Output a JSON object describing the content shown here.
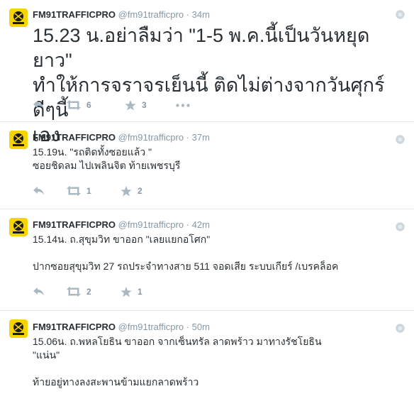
{
  "colors": {
    "avatar_bg": "#f5d400",
    "name": "#292f33",
    "meta": "#8899a6",
    "icon": "#aab8c2"
  },
  "tweets": [
    {
      "fullname": "FM91TRAFFICPRO",
      "username": "@fm91trafficpro",
      "separator": "·",
      "time": "34m",
      "text_lines": [
        "15.23 น.อย่าลืมว่า \"1-5 พ.ค.นี้เป็นวันหยุดยาว\"",
        "ทำให้การจราจรเย็นนี้ ติดไม่ต่างจากวันศุกร์ดีๆนี้",
        "เอง"
      ],
      "retweets": "6",
      "favorites": "3"
    },
    {
      "fullname": "FM91TRAFFICPRO",
      "username": "@fm91trafficpro",
      "separator": "·",
      "time": "37m",
      "text_lines": [
        "15.19น. \"รถติดทั้งซอยแล้ว \"",
        "ซอยชิดลม ไปเพลินจิต ท้ายเพชรบุรี"
      ],
      "retweets": "1",
      "favorites": "2"
    },
    {
      "fullname": "FM91TRAFFICPRO",
      "username": "@fm91trafficpro",
      "separator": "·",
      "time": "42m",
      "text_lines": [
        "15.14น. ถ.สุขุมวิท ขาออก \"เลยแยกอโศก\"",
        "",
        "ปากซอยสุขุมวิท 27 รถประจำทางสาย 511 จอดเสีย ระบบเกียร์ /เบรคล็อค"
      ],
      "retweets": "2",
      "favorites": "1"
    },
    {
      "fullname": "FM91TRAFFICPRO",
      "username": "@fm91trafficpro",
      "separator": "·",
      "time": "50m",
      "text_lines": [
        "15.06น. ถ.พหลโยธิน ขาออก จากเซ็นทรัล ลาดพร้าว มาทางรัชโยธิน",
        "\"แน่น\"",
        "",
        "ท้ายอยู่ทางลงสะพานข้ามแยกลาดพร้าว"
      ]
    }
  ]
}
